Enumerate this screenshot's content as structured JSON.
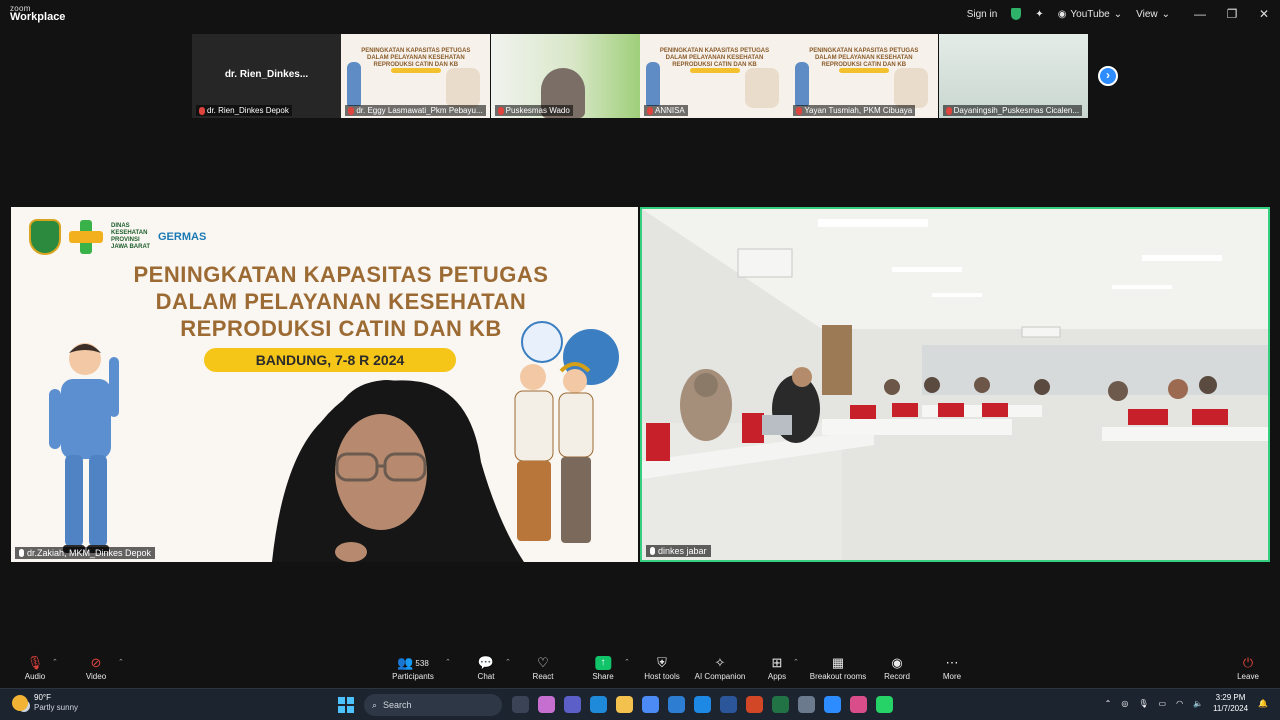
{
  "app": {
    "logo_line1": "zoom",
    "logo_line2": "Workplace"
  },
  "titlebar": {
    "signin": "Sign in",
    "livestream": "YouTube",
    "view": "View"
  },
  "gallery": {
    "tiles": [
      {
        "name": "dr. Rien_Dinkes Depok",
        "center": "dr.  Rien_Dinkes...",
        "kind": "name"
      },
      {
        "name": "dr. Eggy Lasmawati_Pkm Pebayu...",
        "kind": "slide"
      },
      {
        "name": "Puskesmas Wado",
        "kind": "cam-green"
      },
      {
        "name": "ANNISA",
        "kind": "slide"
      },
      {
        "name": "Yayan Tusmiah, PKM Cibuaya",
        "kind": "slide"
      },
      {
        "name": "Dayaningsih_Puskesmas Cicalen...",
        "kind": "cam-blur"
      }
    ],
    "mini_slide_title": "PENINGKATAN KAPASITAS PETUGAS DALAM PELAYANAN KESEHATAN REPRODUKSI CATIN DAN KB"
  },
  "main": {
    "left_caption": "dr.Zakiah, MKM_Dinkes Depok",
    "right_caption": "dinkes jabar",
    "slide": {
      "dinas": [
        "DINAS",
        "KESEHATAN",
        "PROVINSI",
        "JAWA BARAT"
      ],
      "germas": "GERMAS",
      "title_lines": [
        "PENINGKATAN KAPASITAS PETUGAS",
        "DALAM PELAYANAN KESEHATAN",
        "REPRODUKSI CATIN DAN KB"
      ],
      "date_visible": "BANDUNG, 7-8                R 2024"
    }
  },
  "toolbar": {
    "audio": "Audio",
    "video": "Video",
    "participants": "Participants",
    "participants_count": "538",
    "chat": "Chat",
    "react": "React",
    "share": "Share",
    "host_tools": "Host tools",
    "ai_companion": "AI Companion",
    "apps": "Apps",
    "breakout": "Breakout rooms",
    "record": "Record",
    "more": "More",
    "leave": "Leave"
  },
  "taskbar": {
    "temp": "90°F",
    "weather": "Partly sunny",
    "search": "Search",
    "time": "3:29 PM",
    "date": "11/7/2024"
  },
  "colors": {
    "accent_blue": "#2d8cff",
    "active_speaker": "#35d07f",
    "share_green": "#11c46a",
    "slide_title": "#9c6a33",
    "date_pill": "#f5c518"
  }
}
